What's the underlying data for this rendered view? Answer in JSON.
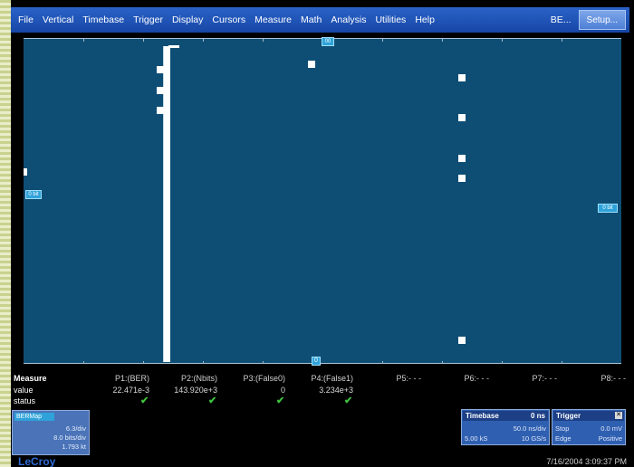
{
  "menu": {
    "items": [
      "File",
      "Vertical",
      "Timebase",
      "Trigger",
      "Display",
      "Cursors",
      "Measure",
      "Math",
      "Analysis",
      "Utilities",
      "Help"
    ],
    "ber_label": "BE...",
    "setup_label": "Setup..."
  },
  "display": {
    "top_marker": "00",
    "bottom_marker": "0",
    "left_label": "0 bit",
    "right_label": "0 bit"
  },
  "measure": {
    "title": "Measure",
    "row_labels": {
      "value": "value",
      "status": "status"
    },
    "params": [
      {
        "name": "P1:(BER)",
        "value": "22.471e-3",
        "status_ok": true
      },
      {
        "name": "P2:(Nbits)",
        "value": "143.920e+3",
        "status_ok": true
      },
      {
        "name": "P3:(False0)",
        "value": "0",
        "status_ok": true
      },
      {
        "name": "P4:(False1)",
        "value": "3.234e+3",
        "status_ok": true
      },
      {
        "name": "P5:- - -",
        "value": "",
        "status_ok": false
      },
      {
        "name": "P6:- - -",
        "value": "",
        "status_ok": false
      },
      {
        "name": "P7:- - -",
        "value": "",
        "status_ok": false
      },
      {
        "name": "P8:- - -",
        "value": "",
        "status_ok": false
      }
    ],
    "check_glyph": "✔"
  },
  "ber_panel": {
    "title": "BERMap",
    "line1": "6.3/div",
    "line2": "8.0 bits/div",
    "line3": "1.793 kt"
  },
  "timebase": {
    "title": "Timebase",
    "offset": "0 ns",
    "per_div": "50.0 ns/div",
    "samples": "5.00 kS",
    "rate": "10 GS/s"
  },
  "trigger": {
    "title": "Trigger",
    "close_glyph": "✕",
    "mode": "Stop",
    "level": "0.0 mV",
    "type": "Edge",
    "slope": "Positive"
  },
  "footer": {
    "brand": "LeCroy",
    "timestamp": "7/16/2004 3:09:37 PM"
  }
}
